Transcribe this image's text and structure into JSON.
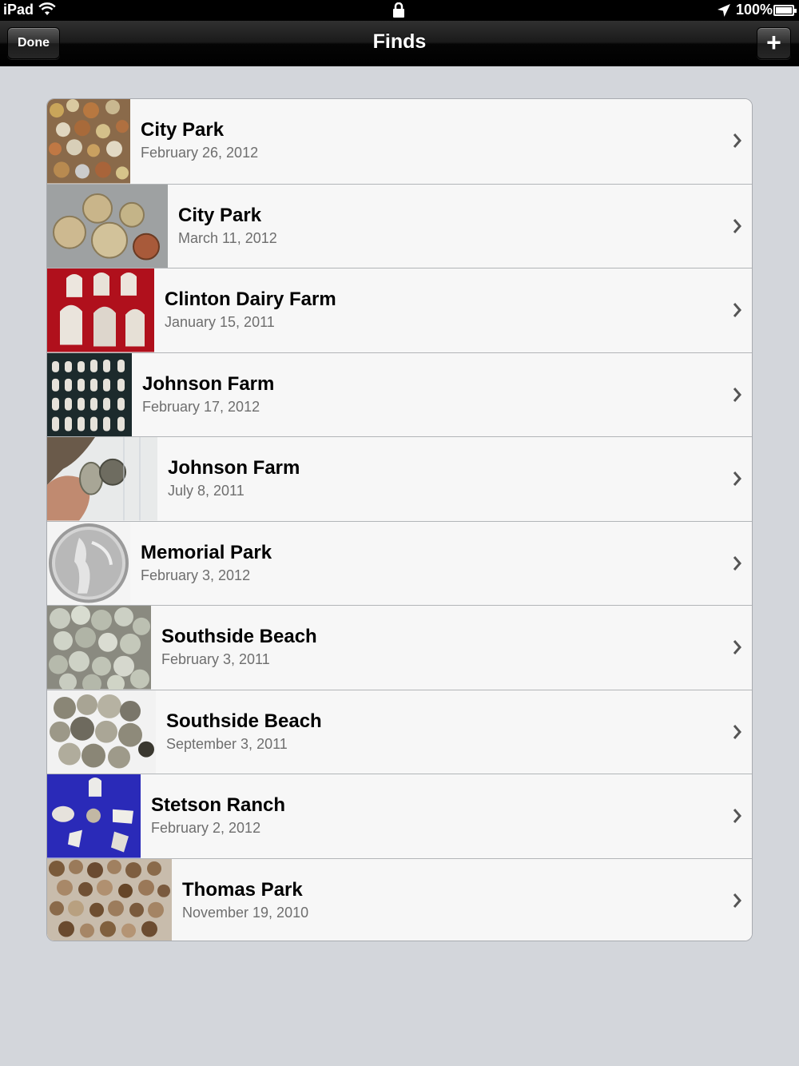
{
  "status_bar": {
    "carrier": "iPad",
    "battery": "100%",
    "icons": [
      "wifi-icon",
      "lock-icon",
      "location-arrow-icon",
      "battery-icon"
    ]
  },
  "nav": {
    "title": "Finds",
    "done_label": "Done",
    "add_label": "+"
  },
  "finds": [
    {
      "title": "City Park",
      "date": "February 26, 2012",
      "thumb": "pile of assorted coins"
    },
    {
      "title": "City Park",
      "date": "March 11, 2012",
      "thumb": "five coins on grey"
    },
    {
      "title": "Clinton Dairy Farm",
      "date": "January 15, 2011",
      "thumb": "bullets on red"
    },
    {
      "title": "Johnson Farm",
      "date": "February 17, 2012",
      "thumb": "rows of bullets on black"
    },
    {
      "title": "Johnson Farm",
      "date": "July 8, 2011",
      "thumb": "hand holding coins"
    },
    {
      "title": "Memorial Park",
      "date": "February 3, 2012",
      "thumb": "walking liberty silver coin"
    },
    {
      "title": "Southside Beach",
      "date": "February 3, 2011",
      "thumb": "pile of silver coins"
    },
    {
      "title": "Southside Beach",
      "date": "September 3, 2011",
      "thumb": "pile of dark coins"
    },
    {
      "title": "Stetson Ranch",
      "date": "February 2, 2012",
      "thumb": "bullets on blue"
    },
    {
      "title": "Thomas Park",
      "date": "November 19, 2010",
      "thumb": "many coins"
    }
  ]
}
